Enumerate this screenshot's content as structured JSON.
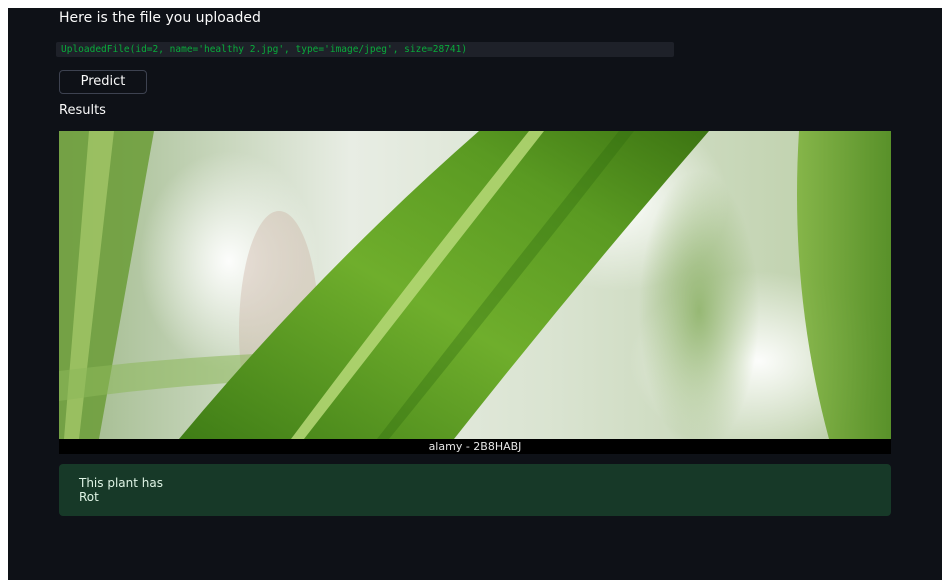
{
  "upload": {
    "heading": "Here is the file you uploaded",
    "file_info": "UploadedFile(id=2, name='healthy 2.jpg', type='image/jpeg', size=28741)"
  },
  "actions": {
    "predict_label": "Predict"
  },
  "results": {
    "label": "Results",
    "image_caption": "alamy - 2B8HABJ",
    "image_subject": "green sugarcane leaf close-up",
    "message_line1": "This plant has",
    "message_line2": "Rot"
  },
  "colors": {
    "app_background": "#0e1117",
    "code_text": "#09ab3b",
    "success_background": "#173928",
    "leaf_green": "#5fa02a"
  }
}
